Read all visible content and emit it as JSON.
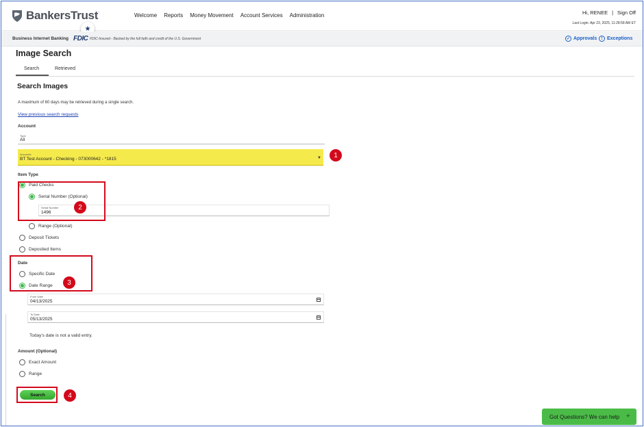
{
  "header": {
    "brand": "BankersTrust",
    "brand_mark": ".",
    "nav": [
      "Welcome",
      "Reports",
      "Money Movement",
      "Account Services",
      "Administration"
    ],
    "greeting": "Hi, RENEE",
    "separator": "|",
    "sign_off": "Sign Off",
    "last_login": "Last Login: Apr 23, 2025, 11:28:58 AM ET"
  },
  "subheader": {
    "label": "Business Internet Banking",
    "fdic": "FDIC",
    "fdic_text": "FDIC-Insured - Backed by the full faith and credit of the U.S. Government",
    "approvals": "Approvals",
    "exceptions": "Exceptions"
  },
  "page": {
    "title": "Image Search",
    "tabs": [
      "Search",
      "Retrieved"
    ]
  },
  "form": {
    "section_title": "Search Images",
    "note": "A maximum of 60 days may be retrieved during a single search.",
    "previous_link": "View previous search requests",
    "account_label": "Account",
    "type_label": "Type",
    "type_value": "All",
    "accounts_label": "Accounts",
    "accounts_value": "BT Test Account - Checking - 073000642 - *1815",
    "item_type_label": "Item Type",
    "paid_checks": "Paid Checks",
    "serial_optional": "Serial Number (Optional)",
    "serial_label": "Serial Number",
    "serial_value": "1496",
    "range_optional": "Range (Optional)",
    "deposit_tickets": "Deposit Tickets",
    "deposited_items": "Deposited Items",
    "date_label": "Date",
    "specific_date": "Specific Date",
    "date_range": "Date Range",
    "from_date_label": "From Date",
    "from_date_value": "04/13/2025",
    "to_date_label": "To Date",
    "to_date_value": "05/13/2025",
    "error": "Today's date is not a valid entry.",
    "amount_label": "Amount (Optional)",
    "exact_amount": "Exact Amount",
    "range": "Range",
    "search_button": "Search"
  },
  "callouts": [
    "1",
    "2",
    "3",
    "4"
  ],
  "help": {
    "label": "Got Questions? We can help",
    "plus": "+"
  },
  "colors": {
    "highlight": "#f5ea4b",
    "callout_red": "#d3091b",
    "accent_green": "#3bb44a",
    "link_blue": "#1a5fc4"
  }
}
